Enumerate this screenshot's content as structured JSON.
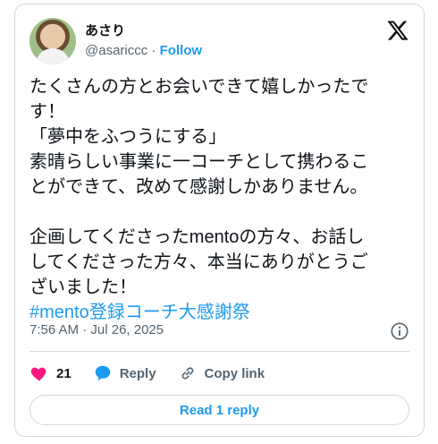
{
  "author": {
    "display_name": "あさり",
    "handle": "@asariccc",
    "separator": "·",
    "follow_label": "Follow"
  },
  "tweet": {
    "body": "たくさんの方とお会いできて嬉しかったで\nす！\n「夢中をふつうにする」\n素晴らしい事業に一コーチとして携わるこ\nとができて、改めて感謝しかありません。\n\n企画してくださったmentoの方々、お話し\nしてくださった方々、本当にありがとうご\nざいました！",
    "hashtag": "#mento登録コーチ大感謝祭"
  },
  "meta": {
    "time": "7:56 AM",
    "separator": "·",
    "date": "Jul 26, 2025"
  },
  "actions": {
    "like_count": "21",
    "reply_label": "Reply",
    "copy_label": "Copy link"
  },
  "read_replies_label": "Read 1 reply",
  "icons": {
    "logo": "x-logo-icon",
    "like": "heart-icon",
    "reply": "speech-bubble-icon",
    "copy": "link-icon",
    "info": "info-icon"
  },
  "colors": {
    "accent": "#1d9bf0",
    "like": "#f91880",
    "muted": "#536471",
    "text": "#0f1419"
  }
}
